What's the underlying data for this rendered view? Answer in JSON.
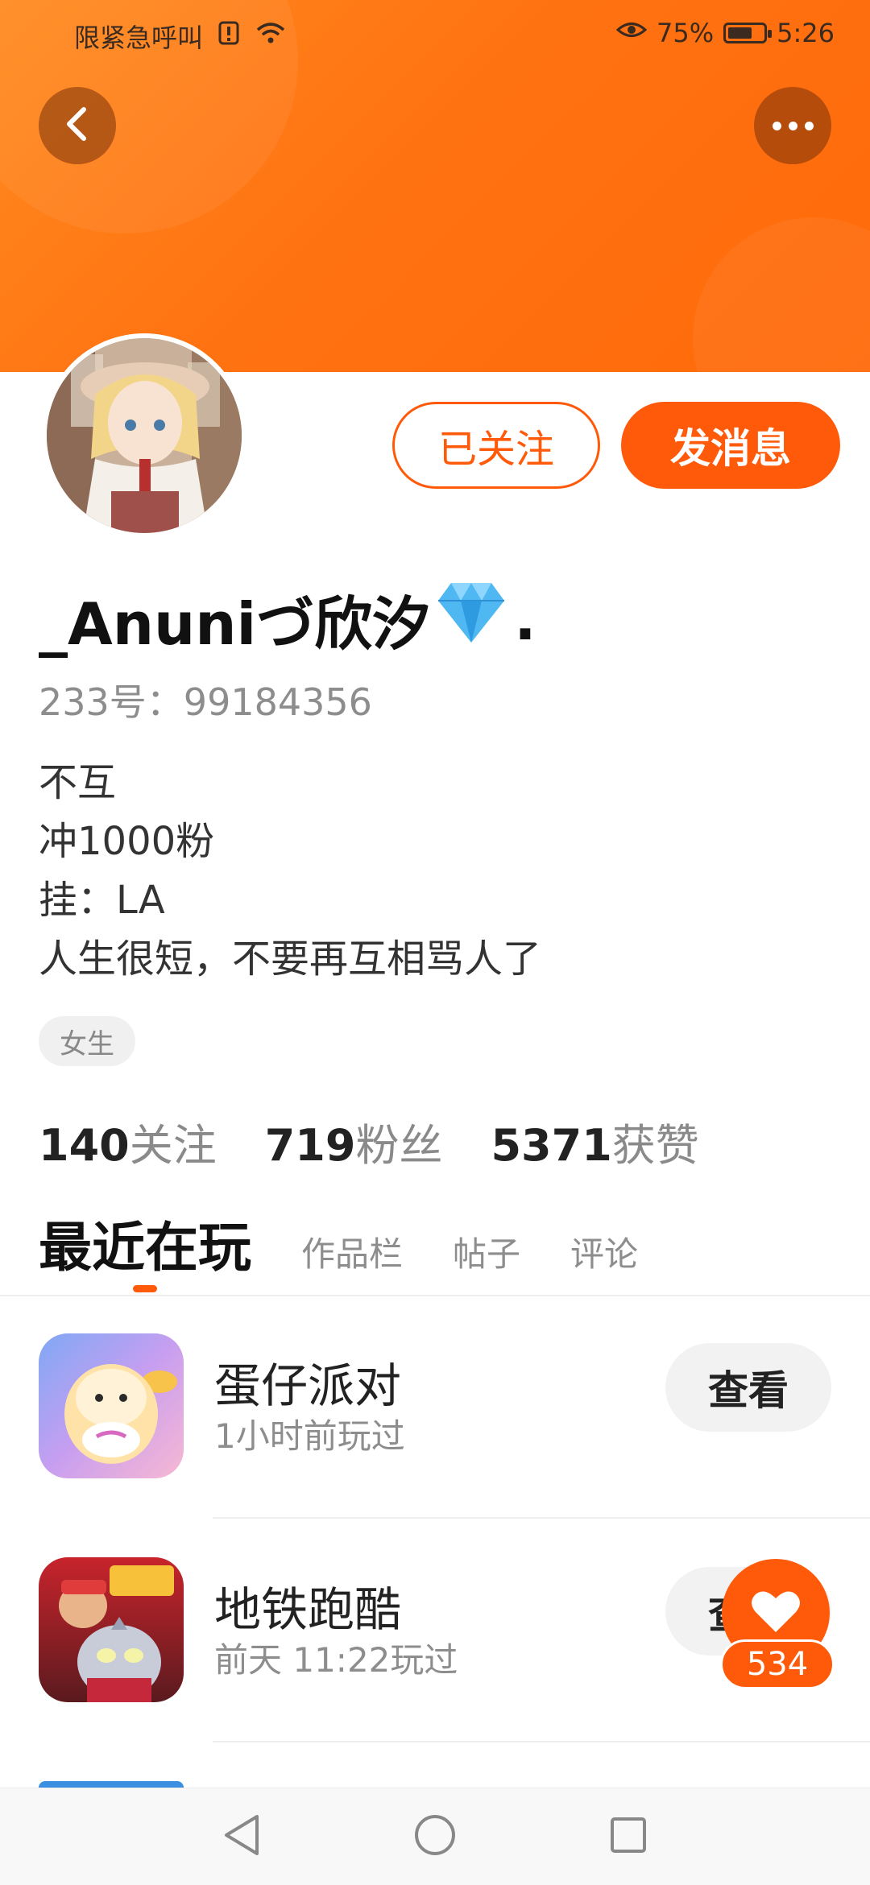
{
  "status_bar": {
    "emergency": "限紧急呼叫",
    "battery": "75%",
    "time": "5:26"
  },
  "header": {
    "back_icon": "chevron-left-icon",
    "more_icon": "more-horizontal-icon"
  },
  "profile": {
    "username": "_Anuniづ欣汐",
    "username_suffix": ".",
    "badge_icon": "diamond-icon",
    "user_id": "233号：99184356",
    "bio_lines": [
      "不互",
      "冲1000粉",
      "挂：LA",
      "人生很短，不要再互相骂人了"
    ],
    "tag": "女生"
  },
  "actions": {
    "follow_label": "已关注",
    "message_label": "发消息"
  },
  "stats": [
    {
      "value": "140",
      "label": "关注"
    },
    {
      "value": "719",
      "label": "粉丝"
    },
    {
      "value": "5371",
      "label": "获赞"
    }
  ],
  "tabs": {
    "active": "最近在玩",
    "others": [
      "作品栏",
      "帖子",
      "评论"
    ]
  },
  "games": [
    {
      "name": "蛋仔派对",
      "time": "1小时前玩过",
      "button": "查看"
    },
    {
      "name": "地铁跑酷",
      "time": "前天 11:22玩过",
      "button": "查看"
    }
  ],
  "like_float": {
    "icon": "heart-icon",
    "count": "534"
  },
  "colors": {
    "accent": "#ff5a0a",
    "header_orange": "#ff7212"
  }
}
